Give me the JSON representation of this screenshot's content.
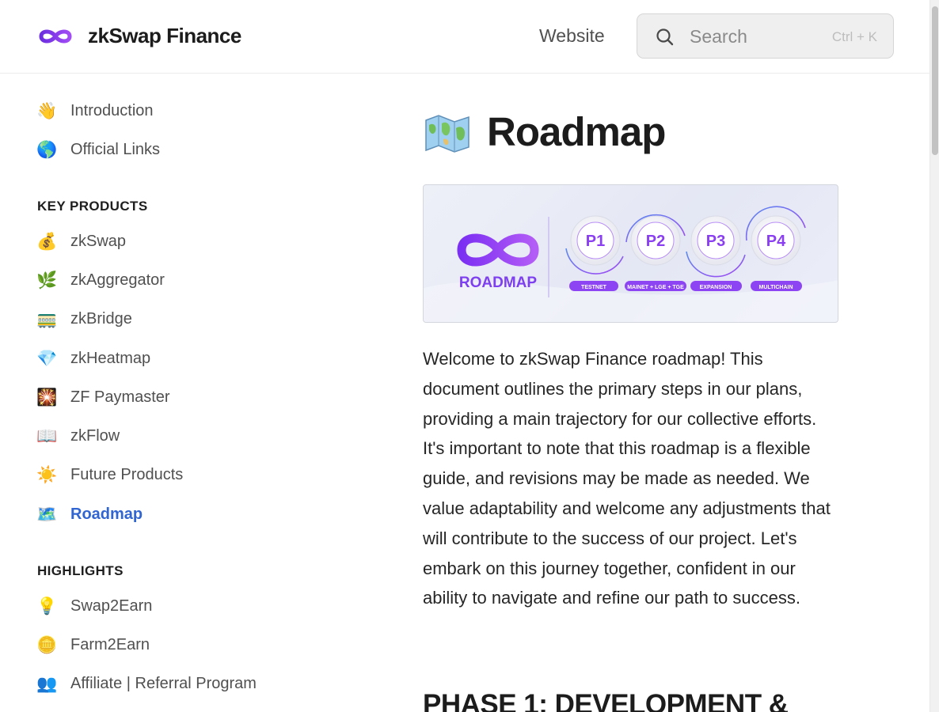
{
  "header": {
    "brand": "zkSwap Finance",
    "website_link": "Website",
    "search_placeholder": "Search",
    "search_shortcut": "Ctrl + K"
  },
  "sidebar": {
    "top_items": [
      {
        "emoji": "👋",
        "icon": "waving-hand-icon",
        "label": "Introduction"
      },
      {
        "emoji": "🌎",
        "icon": "globe-icon",
        "label": "Official Links"
      }
    ],
    "sections": [
      {
        "heading": "KEY PRODUCTS",
        "items": [
          {
            "emoji": "💰",
            "icon": "money-bag-icon",
            "label": "zkSwap"
          },
          {
            "emoji": "🌿",
            "icon": "herb-icon",
            "label": "zkAggregator"
          },
          {
            "emoji": "🚃",
            "icon": "railway-car-icon",
            "label": "zkBridge"
          },
          {
            "emoji": "💎",
            "icon": "gem-icon",
            "label": "zkHeatmap"
          },
          {
            "emoji": "🎇",
            "icon": "sparkler-icon",
            "label": "ZF Paymaster"
          },
          {
            "emoji": "📖",
            "icon": "open-book-icon",
            "label": "zkFlow"
          },
          {
            "emoji": "☀️",
            "icon": "sun-icon",
            "label": "Future Products"
          },
          {
            "emoji": "🗺️",
            "icon": "world-map-icon",
            "label": "Roadmap",
            "active": true
          }
        ]
      },
      {
        "heading": "HIGHLIGHTS",
        "items": [
          {
            "emoji": "💡",
            "icon": "light-bulb-icon",
            "label": "Swap2Earn"
          },
          {
            "emoji": "🪙",
            "icon": "coin-icon",
            "label": "Farm2Earn"
          },
          {
            "emoji": "👥",
            "icon": "people-icon",
            "label": "Affiliate | Referral Program"
          }
        ]
      }
    ]
  },
  "main": {
    "title": "Roadmap",
    "title_icon": "world-map-icon",
    "banner": {
      "label": "ROADMAP",
      "phases": [
        {
          "code": "P1",
          "tag": "TESTNET"
        },
        {
          "code": "P2",
          "tag": "MAINET + LGE + TGE"
        },
        {
          "code": "P3",
          "tag": "EXPANSION"
        },
        {
          "code": "P4",
          "tag": "MULTICHAIN"
        }
      ]
    },
    "intro": "Welcome to zkSwap Finance roadmap! This document outlines the primary steps in our plans, providing a main trajectory for our collective efforts. It's important to note that this roadmap is a flexible guide, and revisions may be made as needed. We value adaptability and welcome any adjustments that will contribute to the success of our project. Let's embark on this journey together, confident in our ability to navigate and refine our path to success.",
    "phase_heading": "PHASE 1: DEVELOPMENT &"
  },
  "colors": {
    "accent": "#3166d2",
    "brand_purple": "#8a3ff0",
    "brand_violet": "#6d3bd6"
  }
}
